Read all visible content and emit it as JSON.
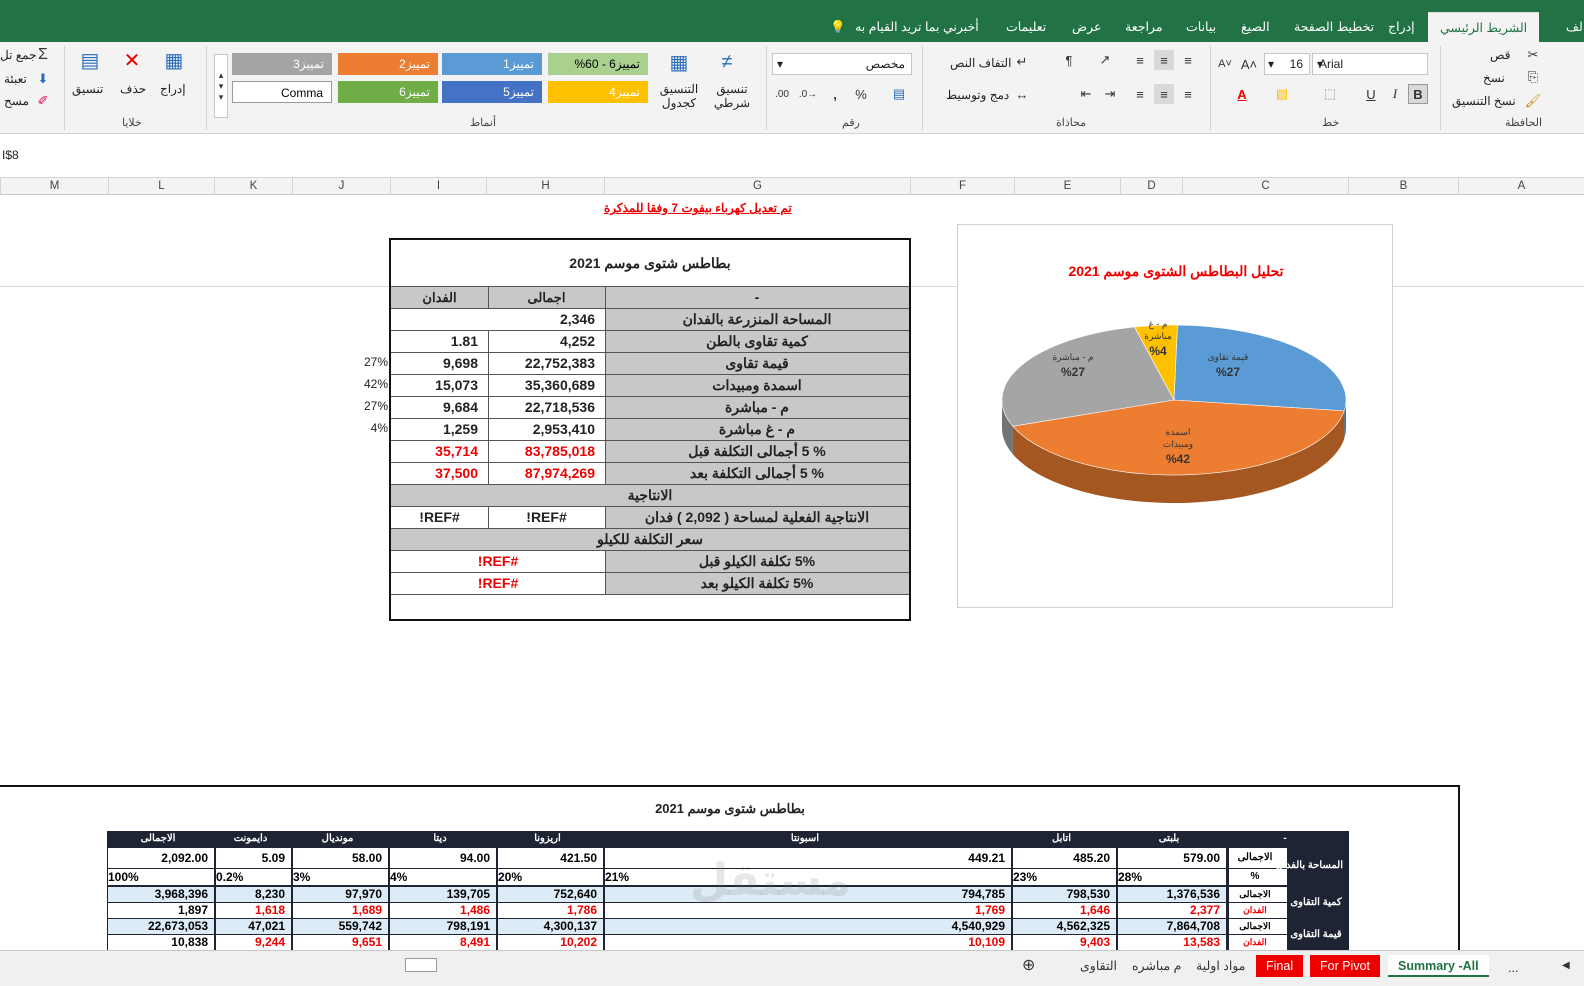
{
  "ribbon_tabs": [
    "الشريط الرئيسي",
    "إدراج",
    "تخطيط الصفحة",
    "الصيغ",
    "بيانات",
    "مراجعة",
    "عرض",
    "تعليمات"
  ],
  "left_cut_tab": "لف",
  "tell_me": "أخبرني بما تريد القيام به",
  "clipboard": {
    "cut": "قص",
    "copy": "نسخ",
    "format_painter": "نسخ التنسيق",
    "group": "الحافظة"
  },
  "font": {
    "name": "Arial",
    "size": "16",
    "group": "خط"
  },
  "alignment": {
    "wrap": "التفاف النص",
    "merge": "دمج وتوسيط",
    "group": "محاذاة"
  },
  "number": {
    "format": "مخصص",
    "group": "رقم"
  },
  "styles": {
    "cond": "تنسيق شرطي",
    "table": "التنسيق كجدول",
    "group": "أنماط",
    "cells": [
      {
        "label": "تمييز6 - 60%",
        "bg": "#a9d08e",
        "fg": "#000"
      },
      {
        "label": "تمييز1",
        "bg": "#5b9bd5",
        "fg": "#fff"
      },
      {
        "label": "تمييز2",
        "bg": "#ed7d31",
        "fg": "#fff"
      },
      {
        "label": "تمييز3",
        "bg": "#a5a5a5",
        "fg": "#fff"
      },
      {
        "label": "تمييز4",
        "bg": "#ffc000",
        "fg": "#fff"
      },
      {
        "label": "تمييز5",
        "bg": "#4472c4",
        "fg": "#fff"
      },
      {
        "label": "تمييز6",
        "bg": "#70ad47",
        "fg": "#fff"
      },
      {
        "label": "Comma",
        "bg": "#ffffff",
        "fg": "#000"
      }
    ]
  },
  "cells_grp": {
    "insert": "إدراج",
    "delete": "حذف",
    "format": "تنسيق",
    "group": "خلايا"
  },
  "editing": {
    "sum": "جمع تل",
    "fill": "تعبئة",
    "clear": "مسح"
  },
  "formula_ref": "I$8",
  "columns": [
    "A",
    "B",
    "C",
    "D",
    "E",
    "F",
    "G",
    "H",
    "I",
    "J",
    "K",
    "L",
    "M"
  ],
  "note": "تم تعديل كهرباء بيفوت 7 وفقا للمذكرة",
  "summary": {
    "title": "بطاطس شتوى موسم 2021",
    "hdr": {
      "dash": "-",
      "total": "اجمالى",
      "feddan": "الفدان"
    },
    "rows": [
      {
        "label": "المساحة المنزرعة بالفدان",
        "total": "2,346",
        "feddan": ""
      },
      {
        "label": "كمية تقاوى بالطن",
        "total": "4,252",
        "feddan": "1.81"
      },
      {
        "label": "قيمة تقاوى",
        "total": "22,752,383",
        "feddan": "9,698",
        "pct": "27%"
      },
      {
        "label": "اسمدة ومبيدات",
        "total": "35,360,689",
        "feddan": "15,073",
        "pct": "42%"
      },
      {
        "label": "م - مباشرة",
        "total": "22,718,536",
        "feddan": "9,684",
        "pct": "27%"
      },
      {
        "label": "م - غ مباشرة",
        "total": "2,953,410",
        "feddan": "1,259",
        "pct": "4%"
      },
      {
        "label": "% 5 أجمالى التكلفة  قبل",
        "total": "83,785,018",
        "feddan": "35,714",
        "red": true
      },
      {
        "label": "% 5 أجمالى التكلفة  بعد",
        "total": "87,974,269",
        "feddan": "37,500",
        "red": true
      }
    ],
    "prod_header": "الانتاجية",
    "prod_row": {
      "label": "الانتاجية الفعلية لمساحة ( 2,092 ) فدان",
      "total": "#REF!",
      "feddan": "#REF!"
    },
    "kilo_header": "سعر التكلفة للكيلو",
    "kilo_rows": [
      {
        "label": "5% تكلفة الكيلو قبل",
        "val": "#REF!"
      },
      {
        "label": "5% تكلفة الكيلو بعد",
        "val": "#REF!"
      }
    ]
  },
  "chart_data": {
    "type": "pie",
    "title": "تحليل البطاطس الشتوى موسم 2021",
    "categories": [
      "قيمة تقاوى",
      "اسمدة ومبيدات",
      "م - مباشرة",
      "م - غ مباشرة"
    ],
    "values": [
      27,
      42,
      27,
      4
    ],
    "labels": [
      "%27",
      "%42",
      "%27",
      "%4"
    ],
    "colors": [
      "#5b9bd5",
      "#ed7d31",
      "#a5a5a5",
      "#ffc000"
    ]
  },
  "bottom": {
    "title": "بطاطس شتوى موسم 2021",
    "headers": [
      "-",
      "بلبتى",
      "اتابل",
      "اسبونتا",
      "اريزونا",
      "ديتا",
      "مونديال",
      "دايمونت",
      "الاجمالى"
    ],
    "area_label": "المساحة بالفدان",
    "area_total_label": "الاجمالى",
    "area": [
      "579.00",
      "485.20",
      "449.21",
      "421.50",
      "94.00",
      "58.00",
      "5.09",
      "2,092.00"
    ],
    "pct_label": "%",
    "pct": [
      "28%",
      "23%",
      "21%",
      "20%",
      "4%",
      "3%",
      "0.2%",
      "100%"
    ],
    "qty_label": "كمية التقاوى",
    "qty_total": [
      "1,376,536",
      "798,530",
      "794,785",
      "752,640",
      "139,705",
      "97,970",
      "8,230",
      "3,968,396"
    ],
    "qty_feddan": [
      "2,377",
      "1,646",
      "1,769",
      "1,786",
      "1,486",
      "1,689",
      "1,618",
      "1,897"
    ],
    "val_label": "قيمة التقاوى",
    "val_total": [
      "7,864,708",
      "4,562,325",
      "4,540,929",
      "4,300,137",
      "798,191",
      "559,742",
      "47,021",
      "22,673,053"
    ],
    "val_feddan": [
      "13,583",
      "9,403",
      "10,109",
      "10,202",
      "8,491",
      "9,651",
      "9,244",
      "10,838"
    ],
    "sub_total": "الاجمالى",
    "sub_feddan": "الفدان"
  },
  "sheet_tabs": [
    "Summary -All",
    "For Pivot",
    "Final",
    "مواد اولية",
    "م مباشره",
    "التقاوى"
  ],
  "ellipsis": "..."
}
